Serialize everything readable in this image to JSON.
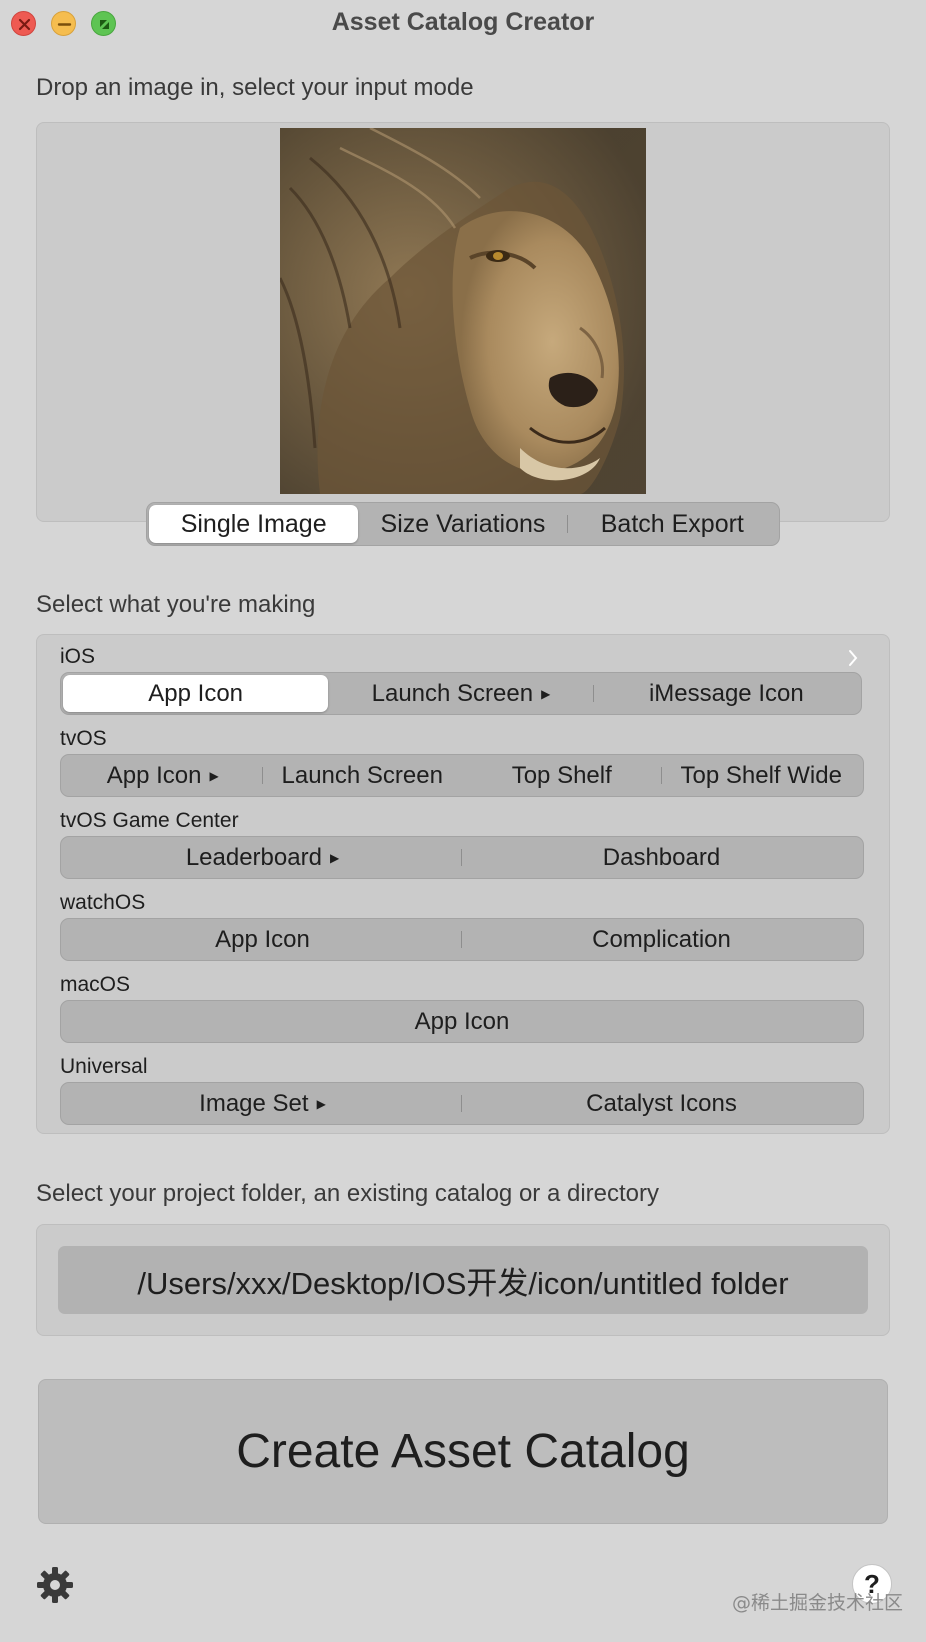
{
  "window": {
    "title": "Asset Catalog Creator",
    "traffic_lights": [
      "close-icon",
      "minimize-icon",
      "zoom-icon"
    ]
  },
  "image_section": {
    "label": "Drop an image in, select your input mode",
    "image": "lion-photo",
    "input_modes": [
      "Single Image",
      "Size Variations",
      "Batch Export"
    ],
    "selected_mode": "Single Image"
  },
  "making_section": {
    "label": "Select what you're making",
    "platforms": {
      "ios": {
        "label": "iOS",
        "options": [
          "App Icon",
          "Launch Screen",
          "iMessage Icon"
        ],
        "selected": "App Icon"
      },
      "tvos": {
        "label": "tvOS",
        "options": [
          "App Icon",
          "Launch Screen",
          "Top Shelf",
          "Top Shelf Wide"
        ]
      },
      "tvos_game_center": {
        "label": "tvOS Game Center",
        "options": [
          "Leaderboard",
          "Dashboard"
        ]
      },
      "watchos": {
        "label": "watchOS",
        "options": [
          "App Icon",
          "Complication"
        ]
      },
      "macos": {
        "label": "macOS",
        "options": [
          "App Icon"
        ]
      },
      "universal": {
        "label": "Universal",
        "options": [
          "Image Set",
          "Catalyst Icons"
        ]
      }
    }
  },
  "folder_section": {
    "label": "Select your project folder, an existing catalog or a directory",
    "path": "/Users/xxx/Desktop/IOS开发/icon/untitled folder"
  },
  "create_button": "Create Asset Catalog",
  "footer": {
    "settings_icon": "gear-icon",
    "help_label": "?",
    "watermark": "@稀土掘金技术社区"
  },
  "colors": {
    "window_bg": "#d6d6d6",
    "panel_bg": "#cbcbcb",
    "segment_bg": "#b3b3b3",
    "segment_selected": "#ffffff",
    "close": "#ee5a52",
    "minimize": "#f5bd4f",
    "zoom": "#5ec453"
  }
}
